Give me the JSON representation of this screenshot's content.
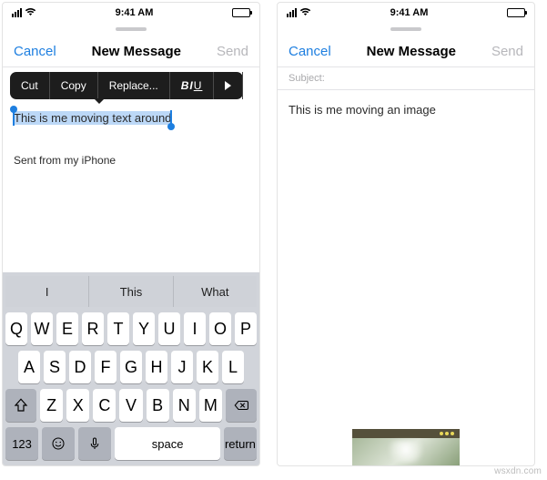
{
  "status": {
    "time": "9:41 AM"
  },
  "nav": {
    "cancel": "Cancel",
    "title": "New Message",
    "send": "Send"
  },
  "ctx": {
    "cut": "Cut",
    "copy": "Copy",
    "replace": "Replace...",
    "biu": "B/U"
  },
  "left": {
    "selected_text": "This is me moving text around",
    "signature": "Sent from my iPhone"
  },
  "right": {
    "subject_label": "Subject:",
    "body": "This is me moving an image"
  },
  "kb": {
    "predict": [
      "I",
      "This",
      "What"
    ],
    "row1": [
      "Q",
      "W",
      "E",
      "R",
      "T",
      "Y",
      "U",
      "I",
      "O",
      "P"
    ],
    "row2": [
      "A",
      "S",
      "D",
      "F",
      "G",
      "H",
      "J",
      "K",
      "L"
    ],
    "row3": [
      "Z",
      "X",
      "C",
      "V",
      "B",
      "N",
      "M"
    ],
    "num": "123",
    "space": "space",
    "return": "return"
  },
  "watermark": "wsxdn.com"
}
